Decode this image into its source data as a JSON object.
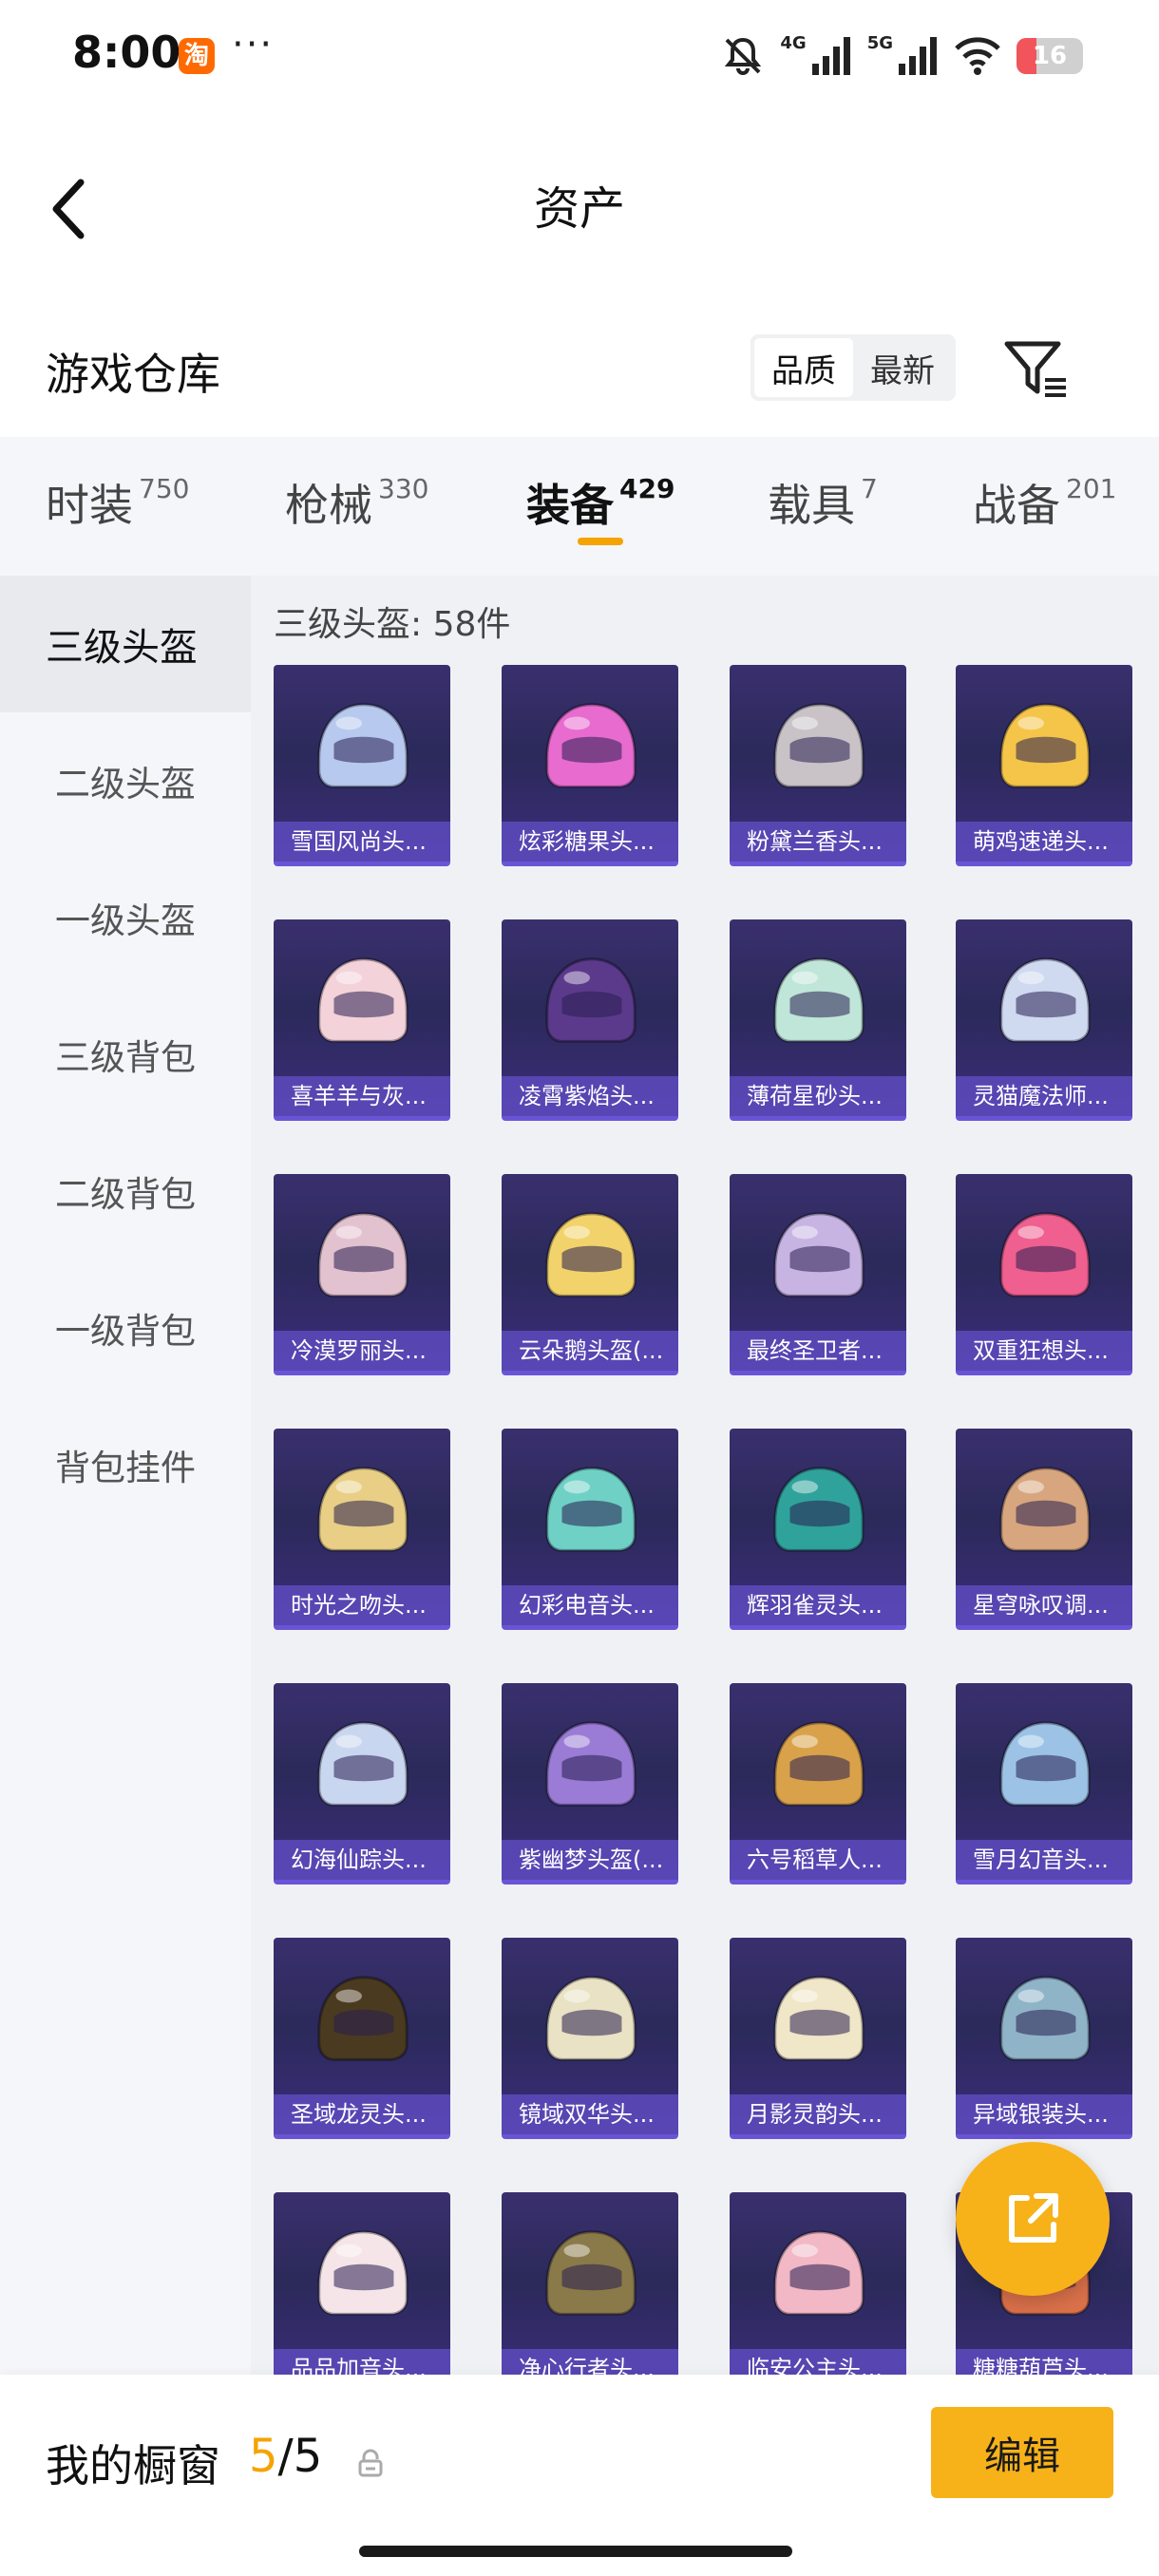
{
  "status_bar": {
    "time": "8:00",
    "app_badge": "淘",
    "more": "···",
    "net_4g": "4G",
    "net_5g": "5G",
    "battery": "16"
  },
  "nav": {
    "title": "资产"
  },
  "section": {
    "title": "游戏仓库",
    "sort_options": [
      "品质",
      "最新"
    ],
    "active_sort": "品质"
  },
  "categories": [
    {
      "label": "时装",
      "count": "750"
    },
    {
      "label": "枪械",
      "count": "330"
    },
    {
      "label": "装备",
      "count": "429"
    },
    {
      "label": "载具",
      "count": "7"
    },
    {
      "label": "战备",
      "count": "201"
    }
  ],
  "active_category": "装备",
  "sidebar": [
    {
      "label": "三级头盔"
    },
    {
      "label": "二级头盔"
    },
    {
      "label": "一级头盔"
    },
    {
      "label": "三级背包"
    },
    {
      "label": "二级背包"
    },
    {
      "label": "一级背包"
    },
    {
      "label": "背包挂件"
    }
  ],
  "active_sidebar": "三级头盔",
  "content": {
    "count_label": "三级头盔: 58件"
  },
  "items": [
    {
      "name": "雪国风尚头...",
      "color": "#b7c9ee"
    },
    {
      "name": "炫彩糖果头...",
      "color": "#e86bd0"
    },
    {
      "name": "粉黛兰香头...",
      "color": "#c9c3c8"
    },
    {
      "name": "萌鸡速递头...",
      "color": "#f5c54a"
    },
    {
      "name": "喜羊羊与灰...",
      "color": "#f3d2d9"
    },
    {
      "name": "凌霄紫焰头...",
      "color": "#5b3a8c"
    },
    {
      "name": "薄荷星砂头...",
      "color": "#bfe6d8"
    },
    {
      "name": "灵猫魔法师...",
      "color": "#cfd9f0"
    },
    {
      "name": "冷漠罗丽头...",
      "color": "#e3c2cf"
    },
    {
      "name": "云朵鹅头盔(...",
      "color": "#f2d36b"
    },
    {
      "name": "最终圣卫者...",
      "color": "#c7b4e3"
    },
    {
      "name": "双重狂想头...",
      "color": "#ef5f8f"
    },
    {
      "name": "时光之吻头...",
      "color": "#e9cf86"
    },
    {
      "name": "幻彩电音头...",
      "color": "#6fd1c6"
    },
    {
      "name": "辉羽雀灵头...",
      "color": "#2fa39b"
    },
    {
      "name": "星穹咏叹调...",
      "color": "#d8a67e"
    },
    {
      "name": "幻海仙踪头...",
      "color": "#c9d6ef"
    },
    {
      "name": "紫幽梦头盔(...",
      "color": "#9a7bd6"
    },
    {
      "name": "六号稻草人...",
      "color": "#d9a24a"
    },
    {
      "name": "雪月幻音头...",
      "color": "#9cc3e6"
    },
    {
      "name": "圣域龙灵头...",
      "color": "#4a3a20"
    },
    {
      "name": "镜域双华头...",
      "color": "#e9e2c4"
    },
    {
      "name": "月影灵韵头...",
      "color": "#f0e6c8"
    },
    {
      "name": "异域银装头...",
      "color": "#8fb4c8"
    },
    {
      "name": "品品加音头...",
      "color": "#f5e5e8"
    },
    {
      "name": "净心行者头...",
      "color": "#8a7a4a"
    },
    {
      "name": "临安公主头...",
      "color": "#f2b8c6"
    },
    {
      "name": "糖糖葫芦头...",
      "color": "#d9704a"
    }
  ],
  "bottom": {
    "showcase_label": "我的橱窗",
    "current": "5",
    "separator": "/",
    "total": "5",
    "edit_label": "编辑"
  },
  "colors": {
    "accent": "#f5a300",
    "card_bg": "#2e2a62",
    "card_label": "#604ec4"
  }
}
